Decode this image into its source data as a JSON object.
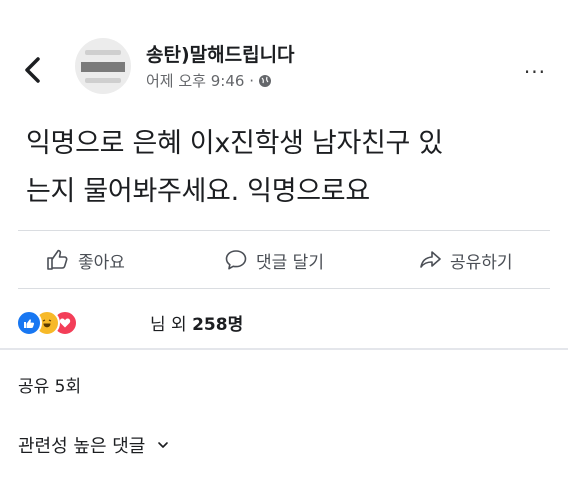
{
  "header": {
    "author": "송탄)말해드립니다",
    "time": "어제 오후 9:46 ·",
    "more": "···"
  },
  "post": {
    "line1": "익명으로 은혜 이x진학생 남자친구 있",
    "line2": "는지 물어봐주세요. 익명으로요"
  },
  "actions": {
    "like": "좋아요",
    "comment": "댓글 달기",
    "share": "공유하기"
  },
  "reactions": {
    "count_prefix": "님 외 ",
    "count_value": "258명"
  },
  "shares": "공유 5회",
  "comments": {
    "sort_label": "관련성 높은 댓글"
  },
  "colors": {
    "like_blue": "#1877f2",
    "haha_yellow": "#f7b928",
    "love_red": "#f33e58",
    "muted_text": "#65676b"
  }
}
